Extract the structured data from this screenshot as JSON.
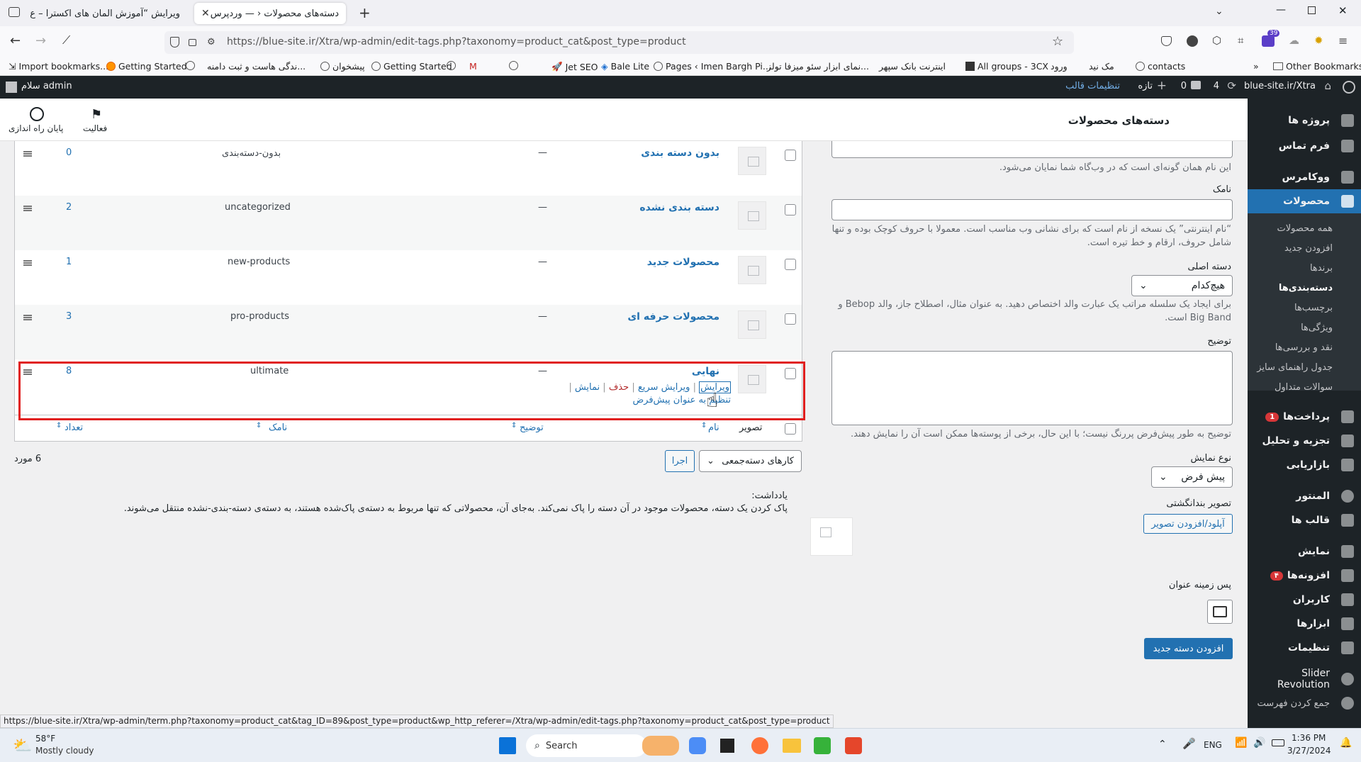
{
  "browser": {
    "tabs": [
      {
        "label": "ویرایش “آموزش المان های اکسترا – ع",
        "active": false
      },
      {
        "label": "دسته‌های محصولات ‹ — وردپرس",
        "active": true
      }
    ],
    "url": "https://blue-site.ir/Xtra/wp-admin/edit-tags.php?taxonomy=product_cat&post_type=product",
    "badge": "39",
    "bookmarks": [
      "Import bookmarks...",
      "Getting Started",
      "...ندگی هاست و ثبت دامنه",
      "پیشخوان",
      "Getting Started",
      "Jet SEO",
      "Bale Lite",
      "Pages ‹ Imen Bargh Pi...",
      "...نمای ابزار سئو میزفا تولز",
      "اینترنت بانک سپهر",
      "All groups - 3CX",
      "ورود",
      "مک نید",
      "contacts"
    ],
    "other_bookmarks": "Other Bookmarks",
    "status_url": "https://blue-site.ir/Xtra/wp-admin/term.php?taxonomy=product_cat&tag_ID=89&post_type=product&wp_http_referer=/Xtra/wp-admin/edit-tags.php?taxonomy=product_cat&post_type=product"
  },
  "adminbar": {
    "site": "blue-site.ir/Xtra",
    "updates": "4",
    "comments": "0",
    "new": "تازه",
    "theme_settings": "تنظیمات قالب",
    "greeting": "سلام admin"
  },
  "header": {
    "title": "دسته‌های محصولات",
    "activity": "فعالیت",
    "finish_setup": "پایان راه اندازی"
  },
  "sidebar": {
    "items": [
      {
        "label": "پروژه ها"
      },
      {
        "label": "فرم تماس"
      },
      {
        "label": "ووکامرس"
      },
      {
        "label": "محصولات"
      }
    ],
    "submenu": [
      "همه محصولات",
      "افزودن جدید",
      "برندها",
      "دسته‌بندی‌ها",
      "برچسب‌ها",
      "ویژگی‌ها",
      "نقد و بررسی‌ها",
      "جدول راهنمای سایز",
      "سوالات متداول"
    ],
    "items2": [
      {
        "label": "پرداخت‌ها",
        "badge": "1"
      },
      {
        "label": "تجزیه و تحلیل"
      },
      {
        "label": "بازاریابی"
      },
      {
        "label": "المنتور"
      },
      {
        "label": "قالب ها"
      },
      {
        "label": "نمایش"
      },
      {
        "label": "افزونه‌ها",
        "badge": "۴"
      },
      {
        "label": "کاربران"
      },
      {
        "label": "ابزارها"
      },
      {
        "label": "تنظیمات"
      },
      {
        "label": "Slider Revolution"
      },
      {
        "label": "جمع کردن فهرست"
      }
    ]
  },
  "form": {
    "name_help": "این نام همان گونه‌ای است که در وب‌گاه شما نمایان می‌شود.",
    "slug_label": "نامک",
    "slug_help": "“نام اینترنتی” یک نسخه از نام است که برای نشانی وب مناسب است. معمولا با حروف کوچک بوده و تنها شامل حروف، ارقام و خط تیره است.",
    "parent_label": "دسته اصلی",
    "parent_value": "هیچ‌کدام",
    "parent_help": "برای ایجاد یک سلسله مراتب یک عبارت والد اختصاص دهید. به عنوان مثال، اصطلاح جاز، والد Bebop و Big Band است.",
    "desc_label": "توضیح",
    "desc_help": "توضیح به طور پیش‌فرض پررنگ نیست؛ با این حال، برخی از پوسته‌ها ممکن است آن را نمایش دهند.",
    "display_label": "نوع نمایش",
    "display_value": "پیش فرض",
    "thumb_label": "تصویر بندانگشتی",
    "upload_button": "آپلود/افزودن تصویر",
    "bg_label": "پس زمینه عنوان",
    "submit": "افزودن دسته جدید"
  },
  "table": {
    "rows": [
      {
        "name": "بدون دسته بندی",
        "desc": "—",
        "slug": "بدون-دسته‌بندی",
        "count": "0"
      },
      {
        "name": "دسته بندی نشده",
        "desc": "—",
        "slug": "uncategorized",
        "count": "2"
      },
      {
        "name": "محصولات جدید",
        "desc": "—",
        "slug": "new-products",
        "count": "1"
      },
      {
        "name": "محصولات حرفه ای",
        "desc": "—",
        "slug": "pro-products",
        "count": "3"
      },
      {
        "name": "نهایی",
        "desc": "—",
        "slug": "ultimate",
        "count": "8"
      }
    ],
    "row_actions": {
      "edit": "ویرایش",
      "quick_edit": "ویرایش سریع",
      "delete": "حذف",
      "view": "نمایش",
      "make_default": "تنظیم به عنوان پیش‌فرض"
    },
    "columns": {
      "image": "تصویر",
      "name": "نام",
      "desc": "توضیح",
      "slug": "نامک",
      "count": "تعداد"
    },
    "bulk_label": "کارهای دسته‌جمعی",
    "apply": "اجرا",
    "items_count": "6 مورد",
    "note_title": "یادداشت:",
    "note_text": "پاک کردن یک دسته، محصولات موجود در آن دسته را پاک نمی‌کند. به‌جای آن، محصولاتی که تنها مربوط به دسته‌ی پاک‌شده هستند، به دسته‌ی دسته-بندی-نشده منتقل می‌شوند."
  },
  "taskbar": {
    "weather_temp": "58°F",
    "weather_desc": "Mostly cloudy",
    "search": "Search",
    "lang": "ENG",
    "time": "1:36 PM",
    "date": "3/27/2024"
  },
  "colors": {
    "accent": "#2271b1",
    "highlight": "#e01e1e",
    "admin_dark": "#1d2327"
  }
}
